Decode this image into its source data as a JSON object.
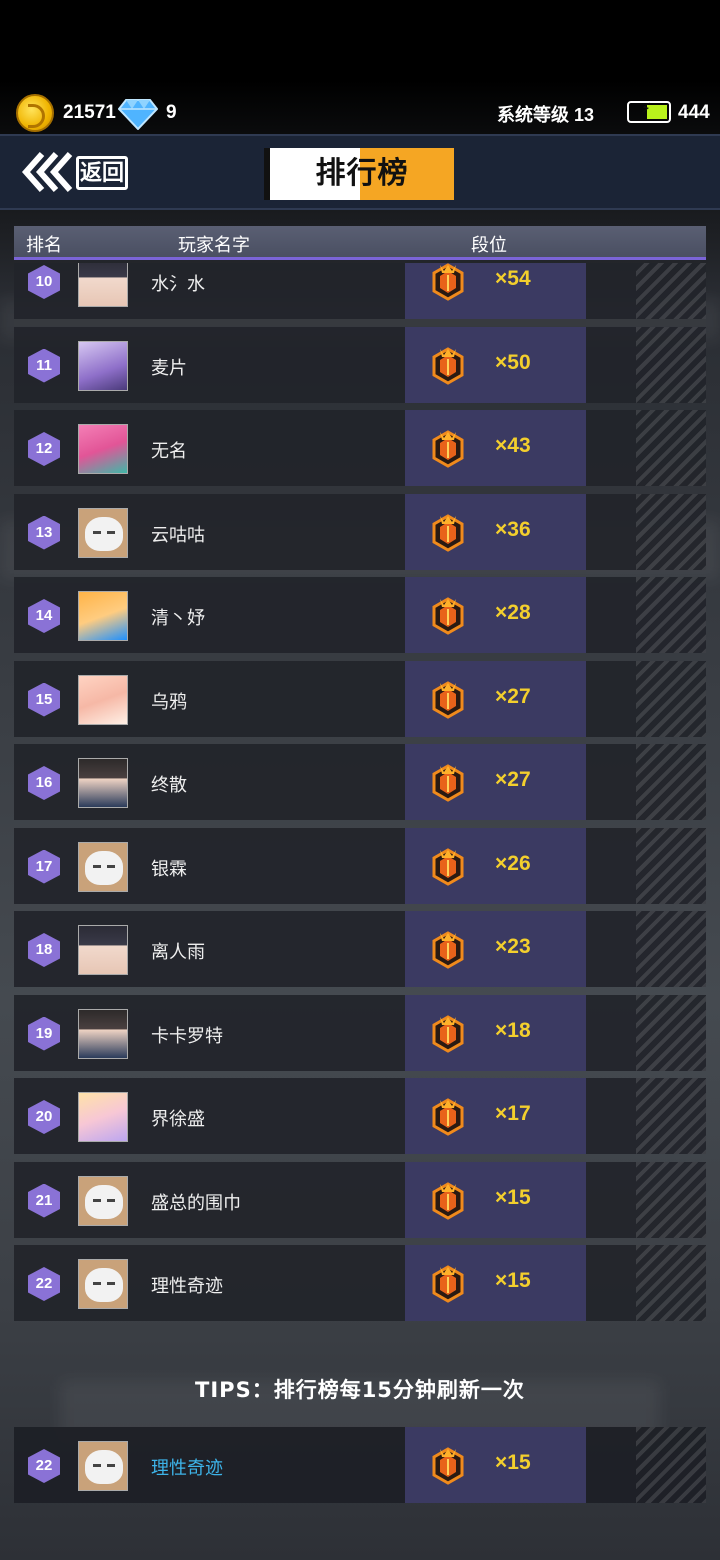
{
  "status": {
    "coins": "21571",
    "gems": "9",
    "system_level": "系统等级 13",
    "energy": "444"
  },
  "header": {
    "back_label": "返回",
    "title": "排行榜"
  },
  "columns": {
    "rank": "排名",
    "player_name": "玩家名字",
    "tier": "段位"
  },
  "rows": [
    {
      "rank": "10",
      "name": "水氵水",
      "multiplier": "×54",
      "avatar": "av-dark"
    },
    {
      "rank": "11",
      "name": "麦片",
      "multiplier": "×50",
      "avatar": "av-purple"
    },
    {
      "rank": "12",
      "name": "无名",
      "multiplier": "×43",
      "avatar": "av-pink"
    },
    {
      "rank": "13",
      "name": "云咕咕",
      "multiplier": "×36",
      "avatar": "av-cat"
    },
    {
      "rank": "14",
      "name": "清丶妤",
      "multiplier": "×28",
      "avatar": "av-orange"
    },
    {
      "rank": "15",
      "name": "乌鸦",
      "multiplier": "×27",
      "avatar": "av-peach"
    },
    {
      "rank": "16",
      "name": "终散",
      "multiplier": "×27",
      "avatar": "av-boy"
    },
    {
      "rank": "17",
      "name": "银霖",
      "multiplier": "×26",
      "avatar": "av-cat"
    },
    {
      "rank": "18",
      "name": "离人雨",
      "multiplier": "×23",
      "avatar": "av-dark"
    },
    {
      "rank": "19",
      "name": "卡卡罗特",
      "multiplier": "×18",
      "avatar": "av-boy"
    },
    {
      "rank": "20",
      "name": "界徐盛",
      "multiplier": "×17",
      "avatar": "av-blonde"
    },
    {
      "rank": "21",
      "name": "盛总的围巾",
      "multiplier": "×15",
      "avatar": "av-cat"
    },
    {
      "rank": "22",
      "name": "理性奇迹",
      "multiplier": "×15",
      "avatar": "av-cat"
    }
  ],
  "tips": "TIPS：排行榜每15分钟刷新一次",
  "self": {
    "rank": "22",
    "name": "理性奇迹",
    "multiplier": "×15",
    "avatar": "av-cat"
  },
  "colors": {
    "rank_hex": "#8a72d6",
    "tier_cell": "#3b3a62",
    "multiplier": "#f3cf2d",
    "self_name": "#3db3e8",
    "title_accent": "#f5a623"
  }
}
